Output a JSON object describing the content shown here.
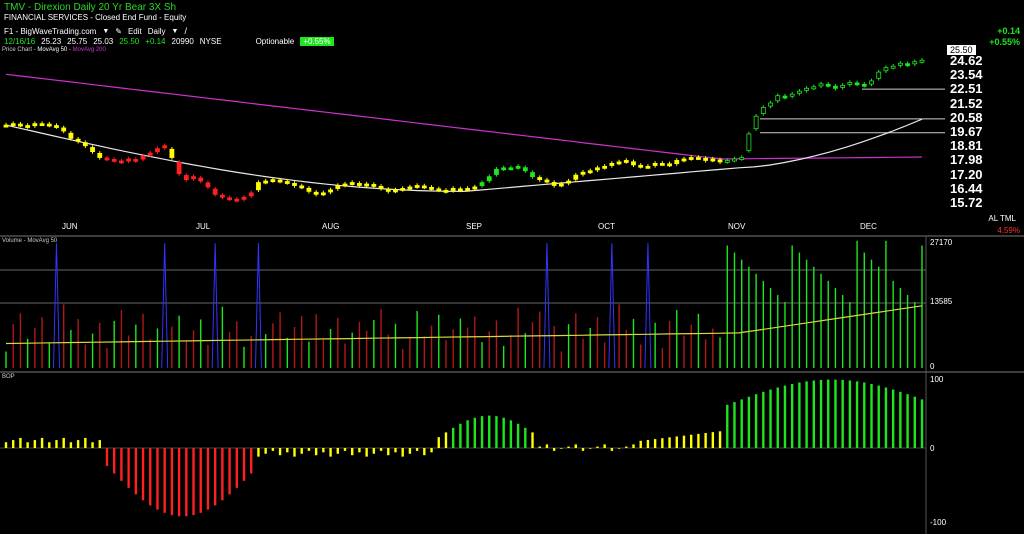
{
  "header": {
    "title": "TMV - Direxion Daily 20 Yr Bear 3X Sh",
    "subtitle": "FINANCIAL SERVICES - Closed End Fund - Equity",
    "source": "F1 - BigWaveTrading.com",
    "edit_label": "Edit",
    "period_label": "Daily",
    "date": "12/16/16",
    "open": "25.23",
    "high": "25.75",
    "low": "25.03",
    "close": "25.50",
    "change": "+0.14",
    "volume": "20990",
    "exchange": "NYSE",
    "optionable": "Optionable",
    "pct_badge": "+0.55%",
    "change_right": "+0.14",
    "pct_right": "+0.55%",
    "price_legend": "Price Chart - MovAvg 50 - MovAvg 200",
    "price_legend_parts": [
      "Price Chart",
      "MovAvg 50",
      "MovAvg 200"
    ],
    "al_tml": "AL TML",
    "bottom_pct": "4.59%"
  },
  "colors": {
    "up": "#1ee61e",
    "neutral": "#ffff00",
    "down": "#ff2020",
    "ma50": "#e8e8e8",
    "ma200": "#cc33cc",
    "vol_ma": "#d8d840",
    "vol_spike": "#3333ff"
  },
  "chart_data": [
    {
      "type": "candlestick",
      "title": "Price Chart",
      "x_labels": [
        "JUN",
        "JUL",
        "AUG",
        "SEP",
        "OCT",
        "NOV",
        "DEC"
      ],
      "y_ticks": [
        "24.62",
        "23.54",
        "22.51",
        "21.52",
        "20.58",
        "19.67",
        "18.81",
        "17.98",
        "17.20",
        "16.44",
        "15.72"
      ],
      "last_price": "25.50",
      "ylim": [
        15.2,
        26.2
      ],
      "closes": [
        21.1,
        21.2,
        21.1,
        21.0,
        21.2,
        21.2,
        21.1,
        21.0,
        20.7,
        20.2,
        20.0,
        19.7,
        19.3,
        18.9,
        18.8,
        18.7,
        18.6,
        18.8,
        18.7,
        19.0,
        19.2,
        19.5,
        19.7,
        18.9,
        17.8,
        17.4,
        17.6,
        17.3,
        16.9,
        16.4,
        16.2,
        16.1,
        16.0,
        16.2,
        16.5,
        17.2,
        17.3,
        17.4,
        17.3,
        17.2,
        17.0,
        16.9,
        16.6,
        16.4,
        16.5,
        16.7,
        17.0,
        17.1,
        17.2,
        17.0,
        17.1,
        17.0,
        16.8,
        16.6,
        16.7,
        16.8,
        16.9,
        17.0,
        16.9,
        16.8,
        16.7,
        16.6,
        16.8,
        16.7,
        16.8,
        16.9,
        17.2,
        17.6,
        18.1,
        18.2,
        18.2,
        18.3,
        18.0,
        17.6,
        17.4,
        17.3,
        17.0,
        17.1,
        17.3,
        17.7,
        17.9,
        18.0,
        18.2,
        18.3,
        18.5,
        18.6,
        18.7,
        18.4,
        18.3,
        18.3,
        18.5,
        18.5,
        18.4,
        18.7,
        18.8,
        18.9,
        18.9,
        18.7,
        18.8,
        18.6,
        18.7,
        18.8,
        18.9,
        20.5,
        21.7,
        22.3,
        22.6,
        23.1,
        23.0,
        23.2,
        23.4,
        23.6,
        23.7,
        23.9,
        23.8,
        23.6,
        23.8,
        24.0,
        23.9,
        23.8,
        24.1,
        24.7,
        25.0,
        25.1,
        25.3,
        25.2,
        25.4,
        25.5
      ],
      "moving_averages": [
        {
          "name": "MovAvg 50",
          "start": 21.1,
          "end": 21.5
        },
        {
          "name": "MovAvg 200",
          "start": 24.55,
          "end": 18.8
        }
      ]
    },
    {
      "type": "bar",
      "title": "Volume",
      "legend": "Volume - MovAvg 50",
      "y_ticks": [
        "27170",
        "13585",
        "0"
      ],
      "ylim": [
        0,
        27170
      ]
    },
    {
      "type": "bar",
      "title": "BOP",
      "y_ticks": [
        "100",
        "0",
        "-100"
      ],
      "ylim": [
        -100,
        100
      ]
    }
  ]
}
